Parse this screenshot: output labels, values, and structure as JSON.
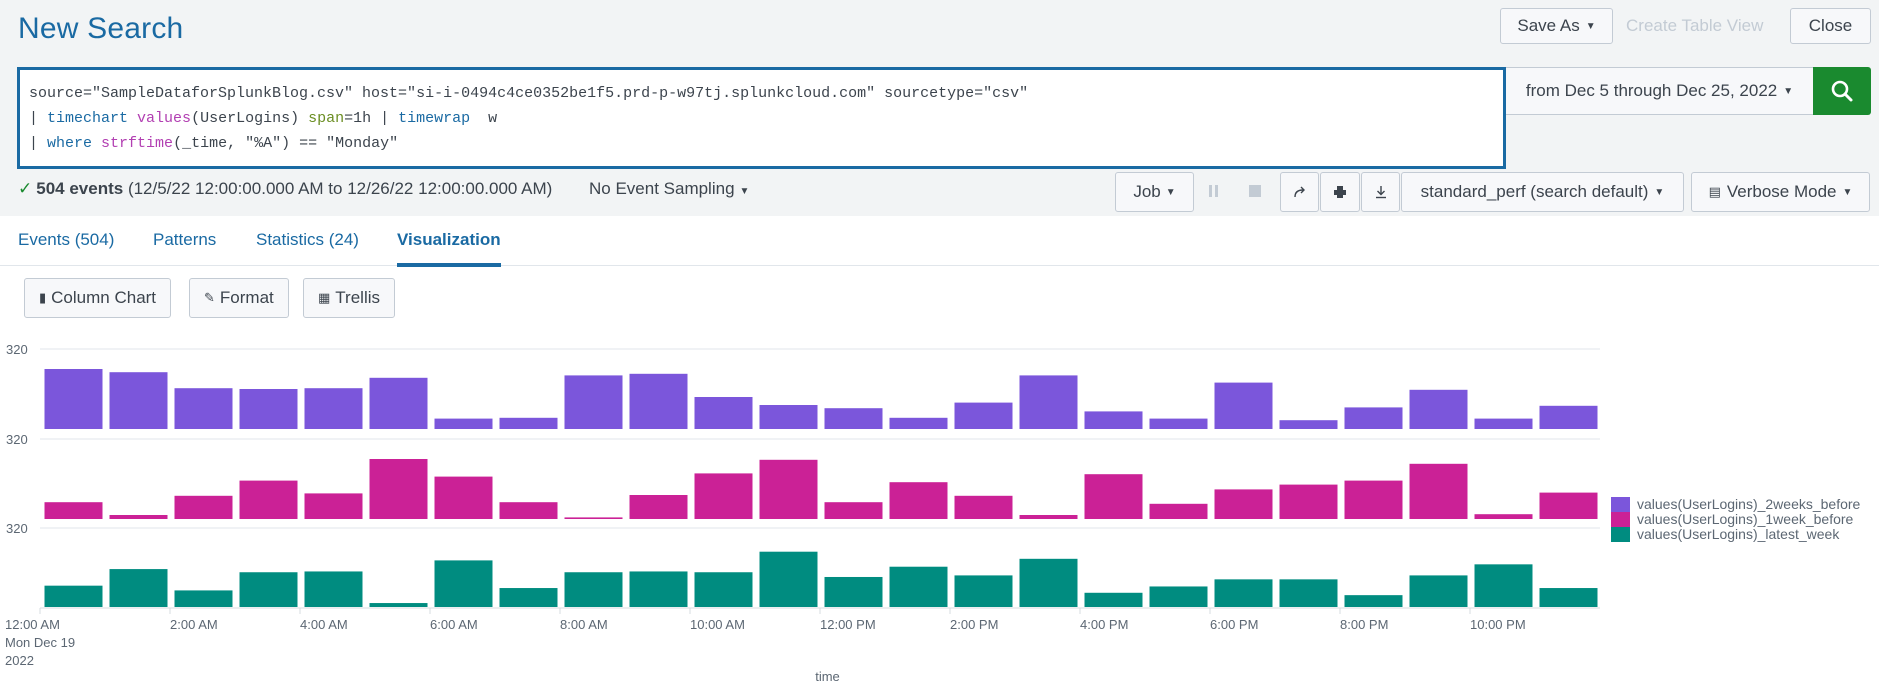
{
  "header": {
    "title": "New Search",
    "save_as": "Save As",
    "create_table_view": "Create Table View",
    "close": "Close"
  },
  "search": {
    "line1": "source=\"SampleDataforSplunkBlog.csv\" host=\"si-i-0494c4ce0352be1f5.prd-p-w97tj.splunkcloud.com\" sourcetype=\"csv\"",
    "line2_pipe": "| ",
    "line2_cmd": "timechart",
    "line2_fn": "values",
    "line2_args": "(UserLogins) ",
    "line2_opt": "span",
    "line2_optval": "=1h | ",
    "line2_cmd2": "timewrap",
    "line2_tail": "  w",
    "line3_pipe": "| ",
    "line3_cmd": "where",
    "line3_fn": "strftime",
    "line3_tail": "(_time, \"%A\") == \"Monday\"",
    "time_range": "from Dec 5 through Dec 25, 2022",
    "search_icon": "search-icon"
  },
  "status": {
    "check": "✓",
    "events": "504 events",
    "range": "(12/5/22 12:00:00.000 AM to 12/26/22 12:00:00.000 AM)",
    "sampling": "No Event Sampling",
    "job": "Job",
    "workload": "standard_perf (search default)",
    "mode": "Verbose Mode"
  },
  "tabs": [
    {
      "label": "Events (504)"
    },
    {
      "label": "Patterns"
    },
    {
      "label": "Statistics (24)"
    },
    {
      "label": "Visualization",
      "active": true
    }
  ],
  "viz_toolbar": {
    "column_chart": "Column Chart",
    "format": "Format",
    "trellis": "Trellis"
  },
  "chart_data": {
    "type": "bar",
    "layout": "stacked-panels",
    "title": "",
    "xlabel": "_time",
    "ylabel": "",
    "panel_top_tick": "320",
    "x_tick_labels": [
      "12:00 AM",
      "2:00 AM",
      "4:00 AM",
      "6:00 AM",
      "8:00 AM",
      "10:00 AM",
      "12:00 PM",
      "2:00 PM",
      "4:00 PM",
      "6:00 PM",
      "8:00 PM",
      "10:00 PM"
    ],
    "x_first_label_sub": [
      "Mon Dec 19",
      "2022"
    ],
    "categories": [
      "00:00",
      "01:00",
      "02:00",
      "03:00",
      "04:00",
      "05:00",
      "06:00",
      "07:00",
      "08:00",
      "09:00",
      "10:00",
      "11:00",
      "12:00",
      "13:00",
      "14:00",
      "15:00",
      "16:00",
      "17:00",
      "18:00",
      "19:00",
      "20:00",
      "21:00",
      "22:00",
      "23:00"
    ],
    "value_units": "fraction of panel max (axis shows only 320 top tick)",
    "series": [
      {
        "name": "values(UserLogins)_2weeks_before",
        "color": "#7b56db",
        "values": [
          0.75,
          0.71,
          0.51,
          0.5,
          0.51,
          0.64,
          0.13,
          0.14,
          0.67,
          0.69,
          0.4,
          0.3,
          0.26,
          0.14,
          0.33,
          0.67,
          0.22,
          0.13,
          0.58,
          0.11,
          0.27,
          0.49,
          0.13,
          0.29
        ]
      },
      {
        "name": "values(UserLogins)_1week_before",
        "color": "#cb2196",
        "values": [
          0.21,
          0.05,
          0.29,
          0.48,
          0.32,
          0.75,
          0.53,
          0.21,
          0.02,
          0.3,
          0.57,
          0.74,
          0.21,
          0.46,
          0.29,
          0.05,
          0.56,
          0.19,
          0.37,
          0.43,
          0.48,
          0.69,
          0.06,
          0.33
        ]
      },
      {
        "name": "values(UserLogins)_latest_week",
        "color": "#008c80",
        "values": [
          0.27,
          0.48,
          0.21,
          0.44,
          0.45,
          0.05,
          0.59,
          0.24,
          0.44,
          0.45,
          0.44,
          0.7,
          0.38,
          0.51,
          0.4,
          0.61,
          0.18,
          0.26,
          0.35,
          0.35,
          0.15,
          0.4,
          0.54,
          0.24
        ]
      }
    ],
    "legend_position": "right",
    "grid": true
  }
}
